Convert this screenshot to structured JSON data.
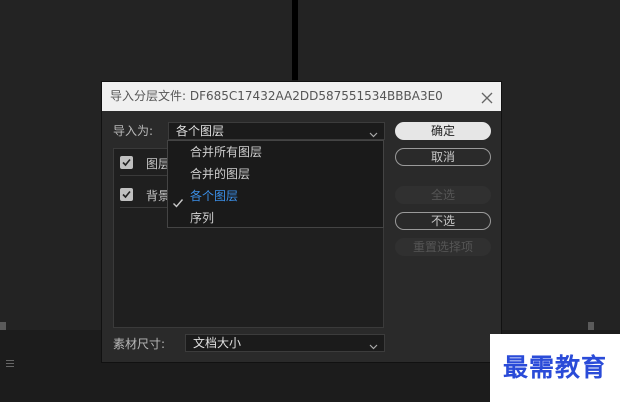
{
  "dialog": {
    "title": "导入分层文件: DF685C17432AA2DD587551534BBBA3E0",
    "import_as_label": "导入为:",
    "import_as_value": "各个图层",
    "layers": [
      {
        "name": "图层",
        "checked": true
      },
      {
        "name": "背景",
        "checked": true
      }
    ],
    "footage_size_label": "素材尺寸:",
    "footage_size_value": "文档大小",
    "buttons": {
      "ok": "确定",
      "cancel": "取消",
      "select_all": "全选",
      "deselect": "不选",
      "reset_selection": "重置选择项"
    },
    "dropdown_options": [
      {
        "label": "合并所有图层",
        "selected": false
      },
      {
        "label": "合并的图层",
        "selected": false
      },
      {
        "label": "各个图层",
        "selected": true
      },
      {
        "label": "序列",
        "selected": false
      }
    ]
  },
  "watermark": {
    "text": "最需教育"
  },
  "colors": {
    "background": "#1c1c1c",
    "dialog_bg": "#2a2a2a",
    "titlebar_bg": "#f0f0f0",
    "selected_option": "#3b8fe8",
    "watermark_text": "#2a4bd8"
  },
  "icons": {
    "close": "close-icon",
    "chevron": "chevron-down-icon",
    "check": "check-icon",
    "panel_menu": "hamburger-icon"
  }
}
